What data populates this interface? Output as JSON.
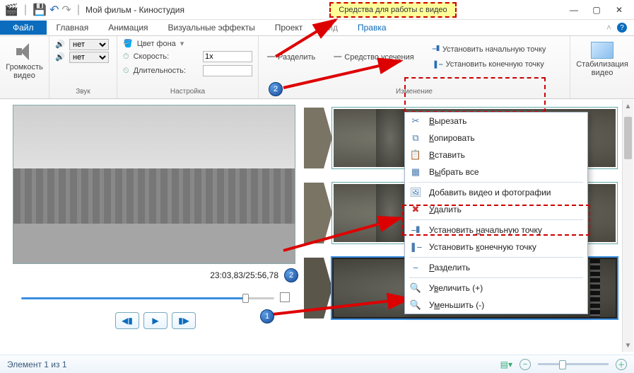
{
  "titlebar": {
    "title": "Мой фильм - Киностудия",
    "callout": "Средства для работы с видео"
  },
  "menu": {
    "file": "Файл",
    "tabs": [
      "Главная",
      "Анимация",
      "Визуальные эффекты",
      "Проект",
      "Вид",
      "Правка"
    ]
  },
  "ribbon": {
    "volume": {
      "label": "Громкость\nвидео"
    },
    "sound": {
      "group": "Звук",
      "fadein_value": "нет",
      "fadeout_value": "нет"
    },
    "settings": {
      "group": "Настройка",
      "bgcolor": "Цвет фона",
      "speed_label": "Скорость:",
      "speed_value": "1x",
      "duration_label": "Длительность:",
      "duration_value": ""
    },
    "changes": {
      "group": "Изменение",
      "split": "Разделить",
      "trim_tool": "Средство усечения",
      "start_point": "Установить начальную точку",
      "end_point": "Установить конечную точку"
    },
    "stabilize": {
      "label": "Стабилизация\nвидео"
    }
  },
  "preview": {
    "time": "23:03,83/25:56,78"
  },
  "context_menu": {
    "cut": "Вырезать",
    "copy": "Копировать",
    "paste": "Вставить",
    "select_all": "Выбрать все",
    "add_media": "Добавить видео и фотографии",
    "delete": "Удалить",
    "start_point": "Установить начальную точку",
    "end_point": "Установить конечную точку",
    "split": "Разделить",
    "zoom_in": "Увеличить (+)",
    "zoom_out": "Уменьшить (-)"
  },
  "status": {
    "text": "Элемент 1 из 1"
  },
  "badges": {
    "one": "1",
    "two": "2"
  }
}
